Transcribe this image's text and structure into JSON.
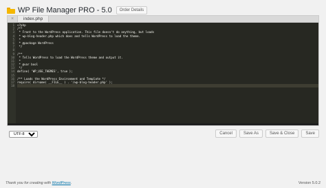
{
  "header": {
    "title": "WP File Manager PRO - 5.0",
    "order_button": "Order Details",
    "icon": "folder-icon"
  },
  "editor": {
    "close_glyph": "×",
    "file_tab": "index.php",
    "line_numbers": [
      "1",
      "2",
      "3",
      "4",
      "5",
      "6",
      "7",
      "8",
      "9",
      "10",
      "11",
      "12",
      "13",
      "14",
      "15",
      "16",
      "17",
      "18"
    ],
    "code_lines": [
      "<?php",
      "/**",
      " * Front to the WordPress application. This file doesn't do anything, but loads",
      " * wp-blog-header.php which does and tells WordPress to load the theme.",
      " *",
      " * @package WordPress",
      " */",
      "",
      "/**",
      " * Tells WordPress to load the WordPress theme and output it.",
      " *",
      " * @var bool",
      " */",
      "define( 'WP_USE_THEMES', true );",
      "",
      "/** Loads the WordPress Environment and Template */",
      "require( dirname( __FILE__ ) . '/wp-blog-header.php' );",
      ""
    ],
    "colors": {
      "background": "#272822",
      "gutter": "#2f3129",
      "text": "#f8f8f2"
    }
  },
  "footer_bar": {
    "encoding_value": "UTF-8",
    "cancel_label": "Cancel",
    "save_as_label": "Save As",
    "save_close_label": "Save & Close",
    "save_label": "Save"
  },
  "page_footer": {
    "credit_prefix": "Thank you for creating with ",
    "credit_link": "WordPress",
    "credit_suffix": ".",
    "version": "Version 5.0.2"
  }
}
